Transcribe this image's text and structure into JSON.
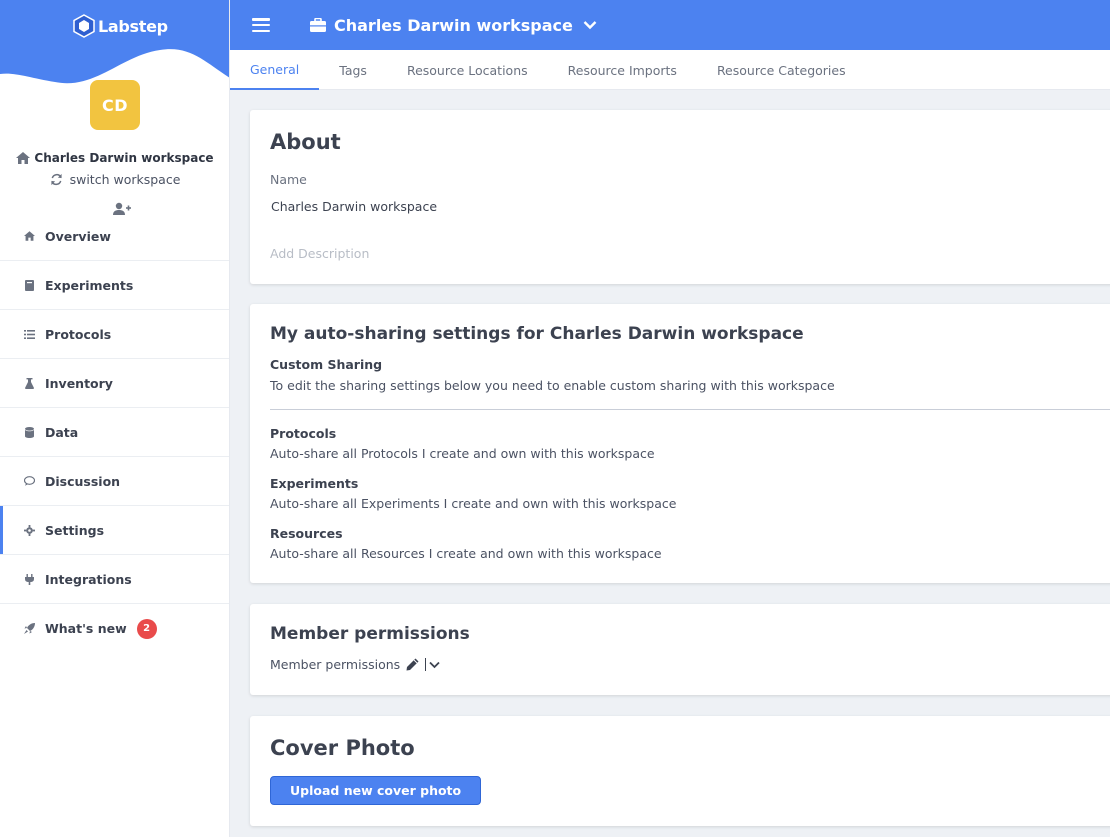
{
  "app": {
    "logo_text": "Labstep"
  },
  "sidebar": {
    "avatar_initials": "CD",
    "workspace_name": "Charles Darwin workspace",
    "switch_label": "switch workspace",
    "items": [
      {
        "label": "Overview",
        "icon": "home-icon"
      },
      {
        "label": "Experiments",
        "icon": "book-icon"
      },
      {
        "label": "Protocols",
        "icon": "list-icon"
      },
      {
        "label": "Inventory",
        "icon": "flask-icon"
      },
      {
        "label": "Data",
        "icon": "database-icon"
      },
      {
        "label": "Discussion",
        "icon": "comment-icon"
      },
      {
        "label": "Settings",
        "icon": "cog-icon",
        "active": true
      },
      {
        "label": "Integrations",
        "icon": "plug-icon"
      },
      {
        "label": "What's new",
        "icon": "rocket-icon",
        "badge": "2"
      }
    ]
  },
  "topbar": {
    "title": "Charles Darwin workspace"
  },
  "tabs": [
    "General",
    "Tags",
    "Resource Locations",
    "Resource Imports",
    "Resource Categories"
  ],
  "about": {
    "heading": "About",
    "name_label": "Name",
    "name_value": "Charles Darwin workspace",
    "description_placeholder": "Add Description"
  },
  "sharing": {
    "heading": "My auto-sharing settings for Charles Darwin workspace",
    "custom_title": "Custom Sharing",
    "custom_text": "To edit the sharing settings below you need to enable custom sharing with this workspace",
    "protocols_title": "Protocols",
    "protocols_text": "Auto-share all Protocols I create and own with this workspace",
    "experiments_title": "Experiments",
    "experiments_text": "Auto-share all Experiments I create and own with this workspace",
    "resources_title": "Resources",
    "resources_text": "Auto-share all Resources I create and own with this workspace"
  },
  "permissions": {
    "heading": "Member permissions",
    "label": "Member permissions"
  },
  "cover": {
    "heading": "Cover Photo",
    "button": "Upload new cover photo"
  },
  "colors": {
    "accent": "#4c82f0",
    "avatar": "#f2c440",
    "badge": "#e94b4b"
  }
}
